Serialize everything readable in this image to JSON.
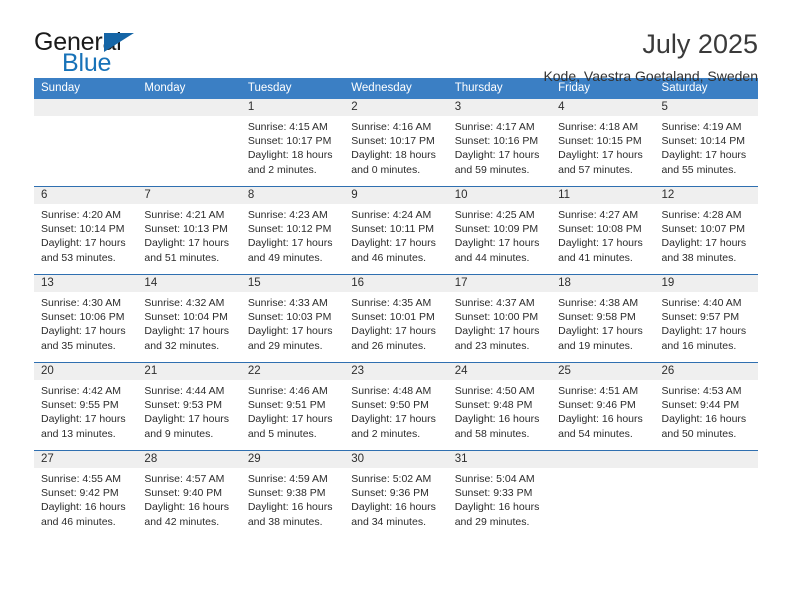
{
  "brand": {
    "name_top": "General",
    "name_bottom": "Blue",
    "accent_color": "#1772b8",
    "triangle_color": "#1565a6"
  },
  "header": {
    "title": "July 2025",
    "subtitle": "Kode, Vaestra Goetaland, Sweden"
  },
  "theme": {
    "header_bar_color": "#3b7fc4",
    "row_divider_color": "#2f6fb0",
    "day_number_band_color": "#efefef",
    "text_color": "#2b2b2b"
  },
  "weekdays": [
    "Sunday",
    "Monday",
    "Tuesday",
    "Wednesday",
    "Thursday",
    "Friday",
    "Saturday"
  ],
  "weeks": [
    [
      {
        "day": "",
        "lines": []
      },
      {
        "day": "",
        "lines": []
      },
      {
        "day": "1",
        "lines": [
          "Sunrise: 4:15 AM",
          "Sunset: 10:17 PM",
          "Daylight: 18 hours",
          "and 2 minutes."
        ]
      },
      {
        "day": "2",
        "lines": [
          "Sunrise: 4:16 AM",
          "Sunset: 10:17 PM",
          "Daylight: 18 hours",
          "and 0 minutes."
        ]
      },
      {
        "day": "3",
        "lines": [
          "Sunrise: 4:17 AM",
          "Sunset: 10:16 PM",
          "Daylight: 17 hours",
          "and 59 minutes."
        ]
      },
      {
        "day": "4",
        "lines": [
          "Sunrise: 4:18 AM",
          "Sunset: 10:15 PM",
          "Daylight: 17 hours",
          "and 57 minutes."
        ]
      },
      {
        "day": "5",
        "lines": [
          "Sunrise: 4:19 AM",
          "Sunset: 10:14 PM",
          "Daylight: 17 hours",
          "and 55 minutes."
        ]
      }
    ],
    [
      {
        "day": "6",
        "lines": [
          "Sunrise: 4:20 AM",
          "Sunset: 10:14 PM",
          "Daylight: 17 hours",
          "and 53 minutes."
        ]
      },
      {
        "day": "7",
        "lines": [
          "Sunrise: 4:21 AM",
          "Sunset: 10:13 PM",
          "Daylight: 17 hours",
          "and 51 minutes."
        ]
      },
      {
        "day": "8",
        "lines": [
          "Sunrise: 4:23 AM",
          "Sunset: 10:12 PM",
          "Daylight: 17 hours",
          "and 49 minutes."
        ]
      },
      {
        "day": "9",
        "lines": [
          "Sunrise: 4:24 AM",
          "Sunset: 10:11 PM",
          "Daylight: 17 hours",
          "and 46 minutes."
        ]
      },
      {
        "day": "10",
        "lines": [
          "Sunrise: 4:25 AM",
          "Sunset: 10:09 PM",
          "Daylight: 17 hours",
          "and 44 minutes."
        ]
      },
      {
        "day": "11",
        "lines": [
          "Sunrise: 4:27 AM",
          "Sunset: 10:08 PM",
          "Daylight: 17 hours",
          "and 41 minutes."
        ]
      },
      {
        "day": "12",
        "lines": [
          "Sunrise: 4:28 AM",
          "Sunset: 10:07 PM",
          "Daylight: 17 hours",
          "and 38 minutes."
        ]
      }
    ],
    [
      {
        "day": "13",
        "lines": [
          "Sunrise: 4:30 AM",
          "Sunset: 10:06 PM",
          "Daylight: 17 hours",
          "and 35 minutes."
        ]
      },
      {
        "day": "14",
        "lines": [
          "Sunrise: 4:32 AM",
          "Sunset: 10:04 PM",
          "Daylight: 17 hours",
          "and 32 minutes."
        ]
      },
      {
        "day": "15",
        "lines": [
          "Sunrise: 4:33 AM",
          "Sunset: 10:03 PM",
          "Daylight: 17 hours",
          "and 29 minutes."
        ]
      },
      {
        "day": "16",
        "lines": [
          "Sunrise: 4:35 AM",
          "Sunset: 10:01 PM",
          "Daylight: 17 hours",
          "and 26 minutes."
        ]
      },
      {
        "day": "17",
        "lines": [
          "Sunrise: 4:37 AM",
          "Sunset: 10:00 PM",
          "Daylight: 17 hours",
          "and 23 minutes."
        ]
      },
      {
        "day": "18",
        "lines": [
          "Sunrise: 4:38 AM",
          "Sunset: 9:58 PM",
          "Daylight: 17 hours",
          "and 19 minutes."
        ]
      },
      {
        "day": "19",
        "lines": [
          "Sunrise: 4:40 AM",
          "Sunset: 9:57 PM",
          "Daylight: 17 hours",
          "and 16 minutes."
        ]
      }
    ],
    [
      {
        "day": "20",
        "lines": [
          "Sunrise: 4:42 AM",
          "Sunset: 9:55 PM",
          "Daylight: 17 hours",
          "and 13 minutes."
        ]
      },
      {
        "day": "21",
        "lines": [
          "Sunrise: 4:44 AM",
          "Sunset: 9:53 PM",
          "Daylight: 17 hours",
          "and 9 minutes."
        ]
      },
      {
        "day": "22",
        "lines": [
          "Sunrise: 4:46 AM",
          "Sunset: 9:51 PM",
          "Daylight: 17 hours",
          "and 5 minutes."
        ]
      },
      {
        "day": "23",
        "lines": [
          "Sunrise: 4:48 AM",
          "Sunset: 9:50 PM",
          "Daylight: 17 hours",
          "and 2 minutes."
        ]
      },
      {
        "day": "24",
        "lines": [
          "Sunrise: 4:50 AM",
          "Sunset: 9:48 PM",
          "Daylight: 16 hours",
          "and 58 minutes."
        ]
      },
      {
        "day": "25",
        "lines": [
          "Sunrise: 4:51 AM",
          "Sunset: 9:46 PM",
          "Daylight: 16 hours",
          "and 54 minutes."
        ]
      },
      {
        "day": "26",
        "lines": [
          "Sunrise: 4:53 AM",
          "Sunset: 9:44 PM",
          "Daylight: 16 hours",
          "and 50 minutes."
        ]
      }
    ],
    [
      {
        "day": "27",
        "lines": [
          "Sunrise: 4:55 AM",
          "Sunset: 9:42 PM",
          "Daylight: 16 hours",
          "and 46 minutes."
        ]
      },
      {
        "day": "28",
        "lines": [
          "Sunrise: 4:57 AM",
          "Sunset: 9:40 PM",
          "Daylight: 16 hours",
          "and 42 minutes."
        ]
      },
      {
        "day": "29",
        "lines": [
          "Sunrise: 4:59 AM",
          "Sunset: 9:38 PM",
          "Daylight: 16 hours",
          "and 38 minutes."
        ]
      },
      {
        "day": "30",
        "lines": [
          "Sunrise: 5:02 AM",
          "Sunset: 9:36 PM",
          "Daylight: 16 hours",
          "and 34 minutes."
        ]
      },
      {
        "day": "31",
        "lines": [
          "Sunrise: 5:04 AM",
          "Sunset: 9:33 PM",
          "Daylight: 16 hours",
          "and 29 minutes."
        ]
      },
      {
        "day": "",
        "lines": []
      },
      {
        "day": "",
        "lines": []
      }
    ]
  ]
}
